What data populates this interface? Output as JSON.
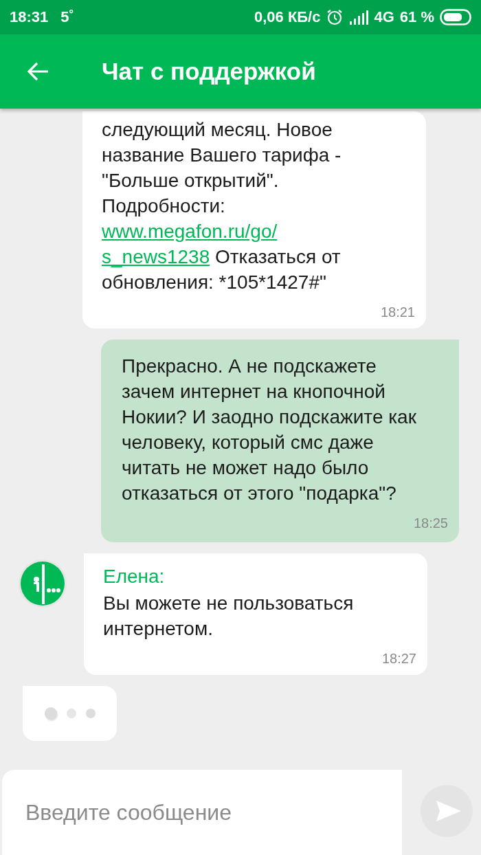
{
  "status_bar": {
    "time": "18:31",
    "temperature": "5˚",
    "speed": "0,06 КБ/с",
    "network": "4G",
    "battery": "61 %"
  },
  "header": {
    "title": "Чат с поддержкой"
  },
  "messages": [
    {
      "kind": "incoming",
      "parts": [
        {
          "kind": "text",
          "text": "следующий месяц. Новое название Вашего тарифа - \"Больше открытий\". Подробности: "
        },
        {
          "kind": "link",
          "text": "www.megafon.ru/go/"
        },
        {
          "kind": "link",
          "text": "s_news1238"
        },
        {
          "kind": "text",
          "text": " Отказаться от обновления: *105*1427#\""
        }
      ],
      "time": "18:21"
    },
    {
      "kind": "outgoing",
      "parts": [
        {
          "kind": "text",
          "text": "Прекрасно. А не подскажете зачем интернет на кнопочной Нокии? И заодно подскажите как человеку, который смс даже читать не может надо было отказаться от этого \"подарка\"?"
        }
      ],
      "time": "18:25"
    },
    {
      "kind": "incoming",
      "sender": "Елена:",
      "avatar": true,
      "parts": [
        {
          "kind": "text",
          "text": "Вы можете не пользоваться интернетом."
        }
      ],
      "time": "18:27"
    },
    {
      "kind": "typing"
    }
  ],
  "composer": {
    "placeholder": "Введите сообщение",
    "send_disabled": true
  }
}
